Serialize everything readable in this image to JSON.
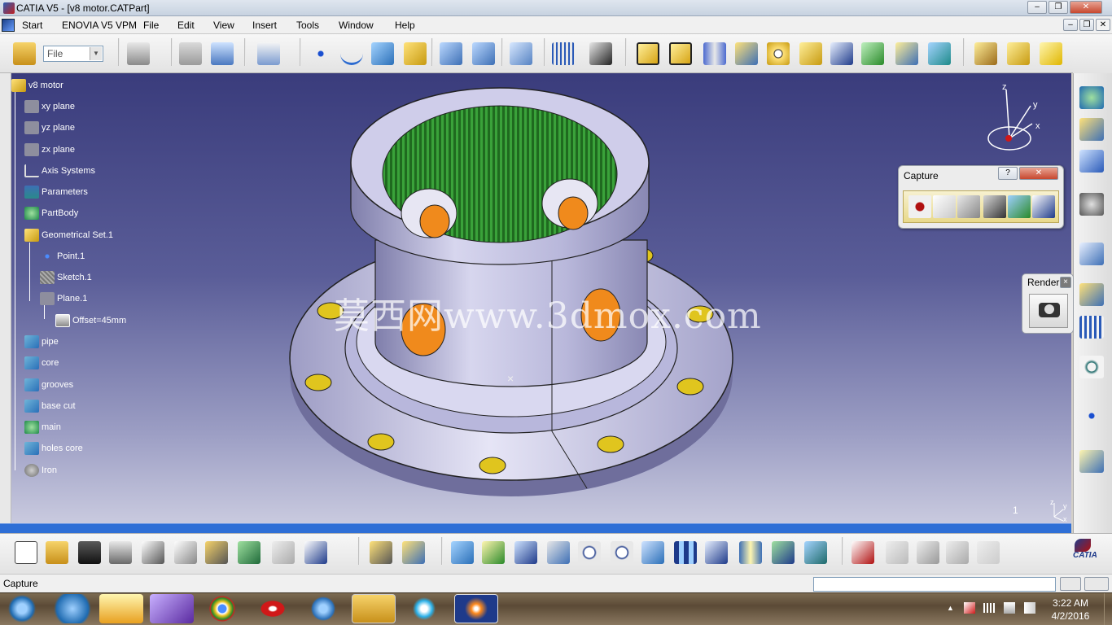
{
  "window": {
    "title": "CATIA V5 - [v8 motor.CATPart]",
    "minimize": "–",
    "restore": "❐",
    "close": "✕",
    "doc_minimize": "–",
    "doc_restore": "❐",
    "doc_close": "✕"
  },
  "menu": {
    "items": [
      "Start",
      "ENOVIA V5 VPM",
      "File",
      "Edit",
      "View",
      "Insert",
      "Tools",
      "Window",
      "Help"
    ]
  },
  "toolbar": {
    "file_combo_value": "File",
    "file_combo_arrow": "▼"
  },
  "tree": {
    "root": "v8 motor",
    "nodes": [
      {
        "label": "xy plane",
        "icon": "plane-icon"
      },
      {
        "label": "yz plane",
        "icon": "plane-icon"
      },
      {
        "label": "zx plane",
        "icon": "plane-icon"
      },
      {
        "label": "Axis Systems",
        "icon": "axis-icon"
      },
      {
        "label": "Parameters",
        "icon": "parameters-icon"
      },
      {
        "label": "PartBody",
        "icon": "gear-body-icon"
      },
      {
        "label": "Geometrical Set.1",
        "icon": "geometrical-set-icon"
      },
      {
        "label": "Point.1",
        "icon": "point-icon"
      },
      {
        "label": "Sketch.1",
        "icon": "sketch-icon"
      },
      {
        "label": "Plane.1",
        "icon": "plane-icon"
      },
      {
        "label": "Offset=45mm",
        "icon": "offset-param-icon"
      },
      {
        "label": "pipe",
        "icon": "body-icon"
      },
      {
        "label": "core",
        "icon": "body-icon"
      },
      {
        "label": "grooves",
        "icon": "body-icon"
      },
      {
        "label": "base cut",
        "icon": "body-icon"
      },
      {
        "label": "main",
        "icon": "gear-body-icon"
      },
      {
        "label": "holes core",
        "icon": "body-icon"
      },
      {
        "label": "Iron",
        "icon": "material-icon"
      }
    ]
  },
  "viewport": {
    "watermark": "莫西网www.3dmox.com",
    "compass_y": "y",
    "compass_x": "x",
    "compass_z": "z",
    "mini_axis_z": "z",
    "mini_axis_y": "y",
    "mini_axis_x": "x",
    "page_number": "1",
    "cursor_mark": "×"
  },
  "capture_panel": {
    "title": "Capture",
    "help": "?",
    "close": "✕"
  },
  "render_panel": {
    "title": "Render",
    "close": "×"
  },
  "status": {
    "text": "Capture"
  },
  "brand": {
    "logo_text": "CATIA"
  },
  "taskbar": {
    "time": "3:22 AM",
    "date": "4/2/2016"
  },
  "colors": {
    "viewport_top": "#3a3c7c",
    "viewport_bottom": "#c9cadf",
    "part_body": "#c6c5e6",
    "hole_fill": "#e0c51e",
    "inner_green": "#2f8a2f",
    "bore_orange": "#f08a1c"
  }
}
